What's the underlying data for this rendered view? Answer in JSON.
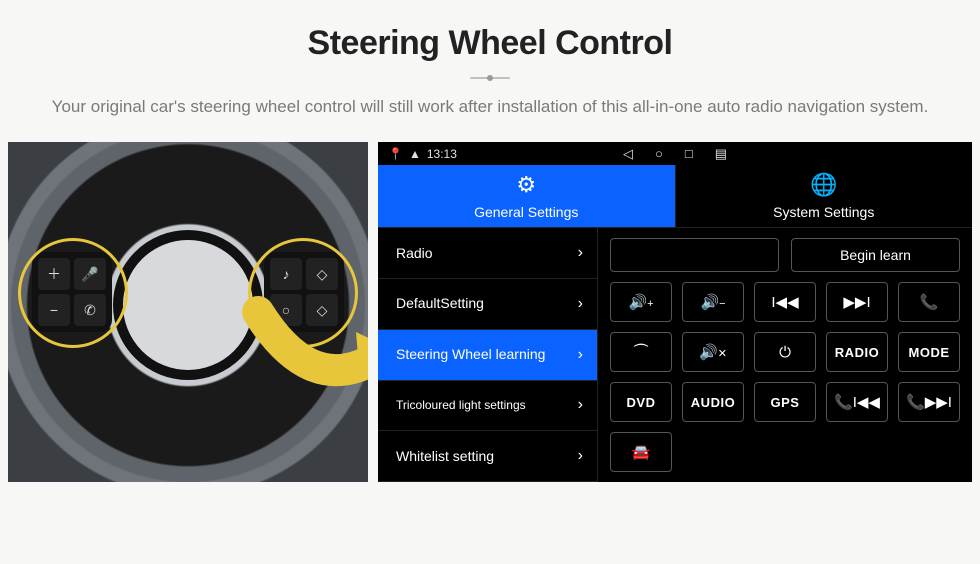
{
  "header": {
    "title": "Steering Wheel Control",
    "subtitle": "Your original car's steering wheel control will still work after installation of this all-in-one auto radio navigation system."
  },
  "statusbar": {
    "time": "13:13"
  },
  "tabs": {
    "general": "General Settings",
    "system": "System Settings"
  },
  "menu": {
    "radio": "Radio",
    "default": "DefaultSetting",
    "swc": "Steering Wheel learning",
    "tricol": "Tricoloured light settings",
    "whitelist": "Whitelist setting"
  },
  "panel": {
    "begin": "Begin learn",
    "buttons": {
      "vol_up": "🔊+",
      "vol_dn": "🔊−",
      "prev": "⏮",
      "next": "⏭",
      "call": "📞",
      "hang": "⌒",
      "mute": "🔇",
      "power": "⏻",
      "radio": "RADIO",
      "mode": "MODE",
      "dvd": "DVD",
      "audio": "AUDIO",
      "gps": "GPS",
      "call_prev": "📞⏮",
      "call_next": "📞⏭",
      "car": "🚘"
    }
  }
}
